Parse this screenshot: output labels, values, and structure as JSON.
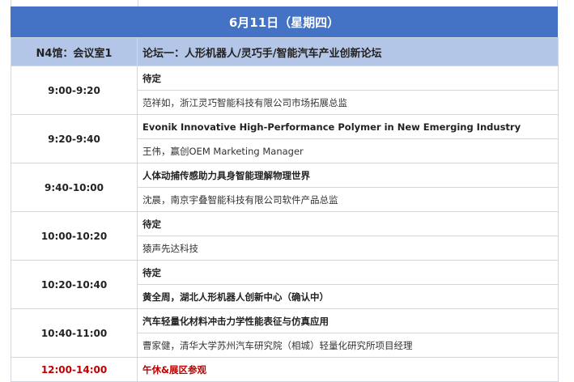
{
  "date_header": "6月11日（星期四）",
  "venue": "N4馆：会议室1",
  "forum": "论坛一：人形机器人/灵巧手/智能汽车产业创新论坛",
  "sessions": [
    {
      "time": "9:00-9:20",
      "title": "待定",
      "speaker": "范祥如，浙江灵巧智能科技有限公司市场拓展总监"
    },
    {
      "time": "9:20-9:40",
      "title": "Evonik Innovative High-Performance Polymer in New Emerging Industry",
      "speaker": "王伟，赢创OEM Marketing Manager"
    },
    {
      "time": "9:40-10:00",
      "title": "人体动捕传感助力具身智能理解物理世界",
      "speaker": "沈晨，南京宇叠智能科技有限公司软件产品总监"
    },
    {
      "time": "10:00-10:20",
      "title": "待定",
      "speaker": "猿声先达科技"
    },
    {
      "time": "10:20-10:40",
      "title": "待定",
      "speaker": "黄全周，湖北人形机器人创新中心（确认中）"
    },
    {
      "time": "10:40-11:00",
      "title": "汽车轻量化材料冲击力学性能表征与仿真应用",
      "speaker": "曹家健，清华大学苏州汽车研究院（相城）轻量化研究所项目经理"
    }
  ],
  "break": {
    "time": "12:00-14:00",
    "label": "午休&展区参观"
  }
}
